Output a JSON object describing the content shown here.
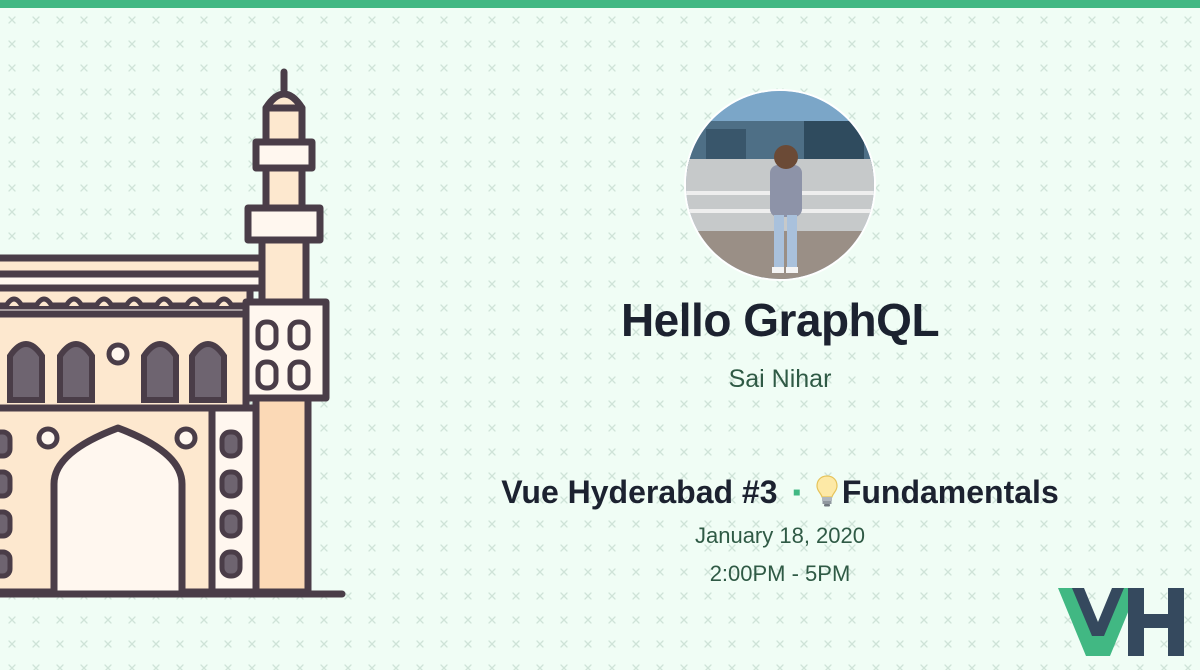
{
  "event": {
    "talk_title": "Hello GraphQL",
    "speaker": "Sai Nihar",
    "name": "Vue Hyderabad #3",
    "separator": "▪",
    "theme": "Fundamentals",
    "date": "January 18, 2020",
    "time": "2:00PM - 5PM"
  },
  "colors": {
    "background": "#f0fdf5",
    "accent": "#41b883",
    "dark": "#1c2230",
    "muted_text": "#2f5a45",
    "logo_dark": "#35495e"
  },
  "icons": {
    "theme_icon": "lightbulb-icon",
    "illustration": "charminar-monument",
    "brand": "vh-logo"
  }
}
